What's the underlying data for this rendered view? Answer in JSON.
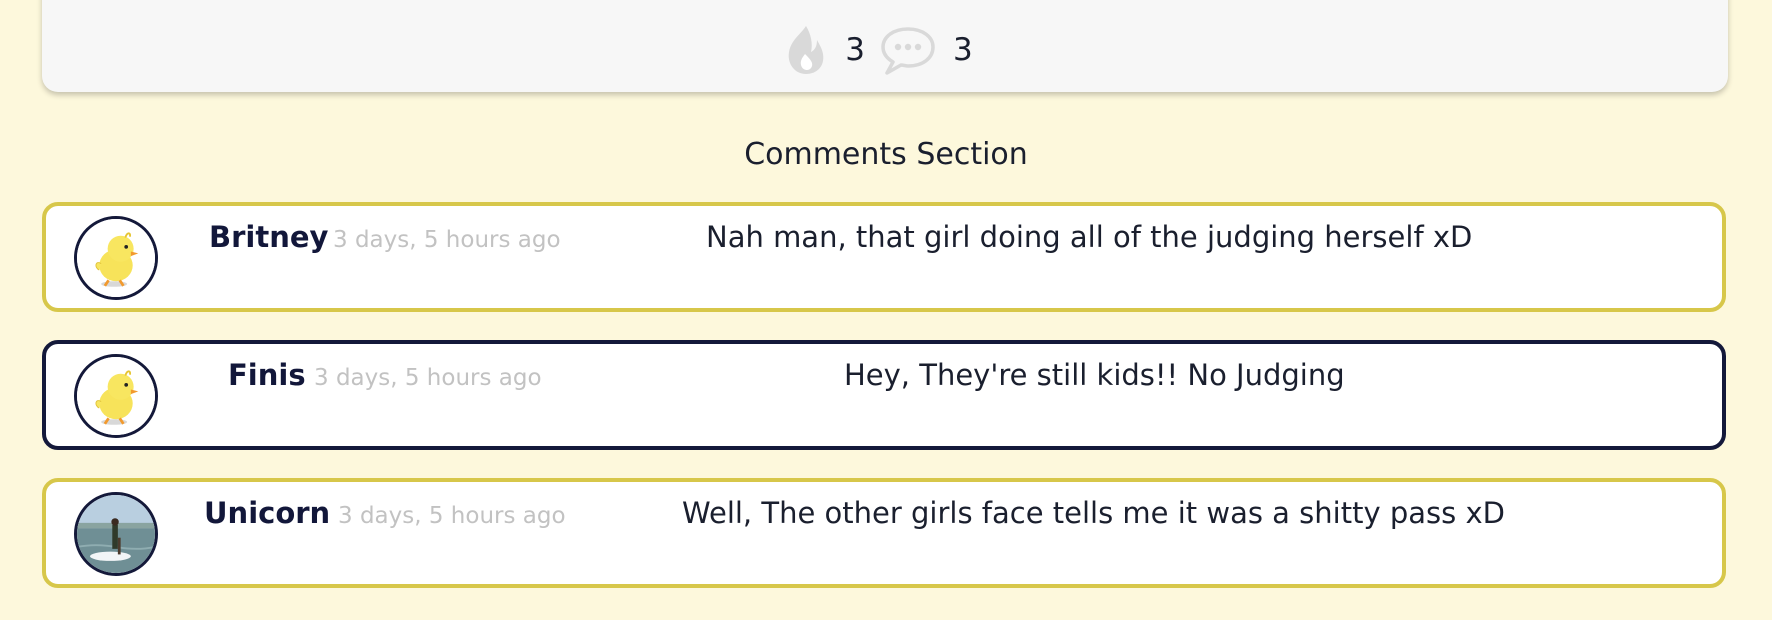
{
  "post": {
    "likes_count": "3",
    "comments_count": "3",
    "like_icon": "flame-icon",
    "comment_icon": "chat-bubble-icon"
  },
  "comments_section": {
    "title": "Comments Section"
  },
  "comments": [
    {
      "username": "Britney",
      "time": "3 days, 5 hours ago",
      "text": "Nah man, that girl doing all of the judging herself xD",
      "avatar": "duck-avatar",
      "border_color": "#d7c74a"
    },
    {
      "username": "Finis",
      "time": "3 days, 5 hours ago",
      "text": "Hey, They're still kids!! No Judging",
      "avatar": "duck-avatar",
      "border_color": "#14193a"
    },
    {
      "username": "Unicorn",
      "time": "3 days, 5 hours ago",
      "text": "Well, The other girls face tells me it was a shitty pass xD",
      "avatar": "paddleboard-photo-avatar",
      "border_color": "#d7c74a"
    }
  ]
}
